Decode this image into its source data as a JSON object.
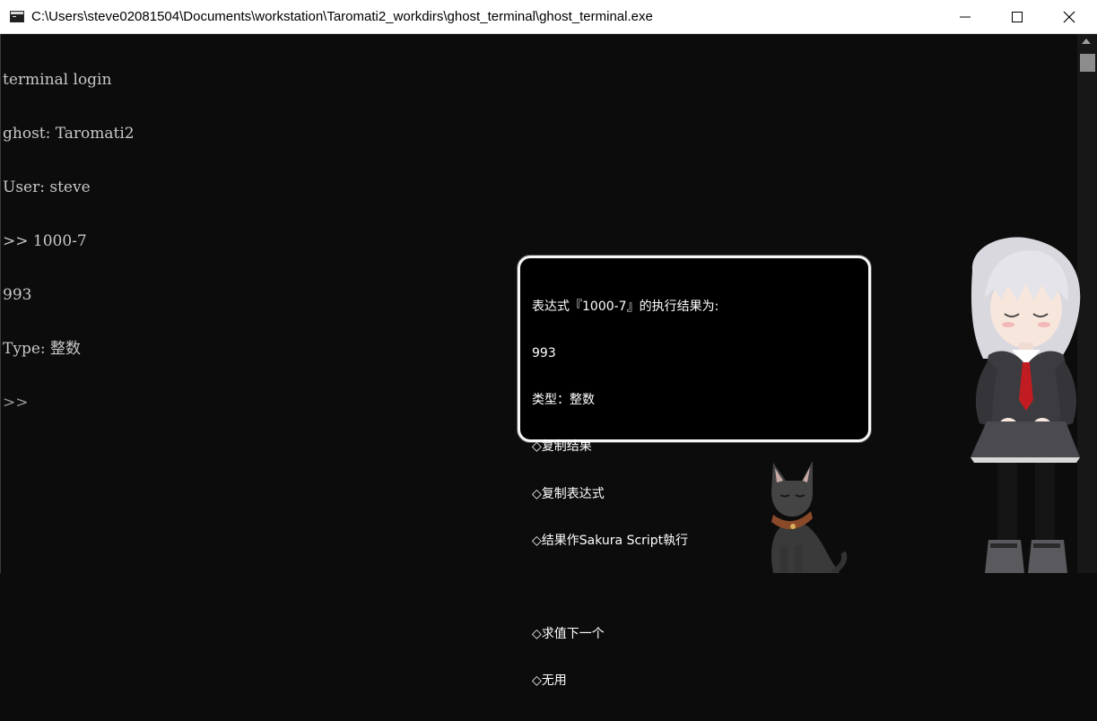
{
  "window": {
    "title": "C:\\Users\\steve02081504\\Documents\\workstation\\Taromati2_workdirs\\ghost_terminal\\ghost_terminal.exe",
    "controls": [
      "minimize",
      "maximize",
      "close"
    ]
  },
  "console": {
    "lines": [
      "terminal login",
      "ghost: Taromati2",
      "User: steve",
      ">> 1000-7",
      "993",
      "Type: 整数"
    ],
    "prompt": ">>"
  },
  "balloon": {
    "header": "表达式『1000-7』的执行结果为:",
    "result": "993",
    "type_line": "类型：整数",
    "choices": [
      "◇复制结果",
      "◇复制表达式",
      "◇结果作Sakura Script執行"
    ],
    "choices2": [
      "◇求值下一个",
      "◇无用"
    ]
  },
  "colors": {
    "console_bg": "#0c0c0c",
    "console_text": "#c8c8c8",
    "titlebar_bg": "#ffffff",
    "balloon_bg": "#000000",
    "balloon_border": "#f5f5f5"
  },
  "icons": [
    "console-app-icon",
    "minimize-icon",
    "maximize-icon",
    "close-icon",
    "scroll-up-arrow-icon"
  ]
}
